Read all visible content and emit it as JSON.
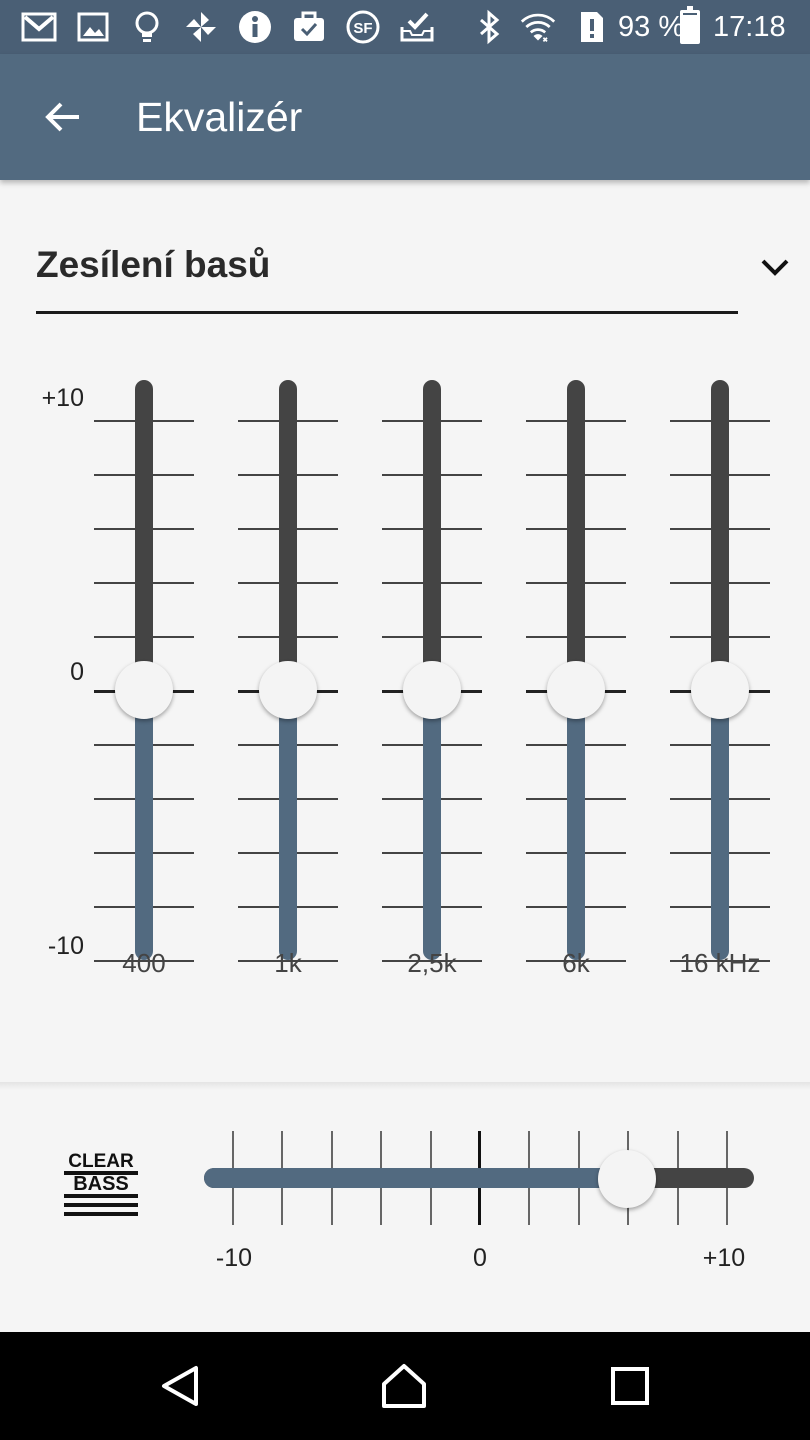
{
  "status_bar": {
    "icons": [
      "gmail-icon",
      "image-icon",
      "lightbulb-icon",
      "pinwheel-icon",
      "info-icon",
      "briefcase-icon",
      "sf-icon",
      "inbox-check-icon",
      "bluetooth-icon",
      "wifi-icon",
      "sim-alert-icon",
      "battery-icon"
    ],
    "battery": "93 %",
    "battery_level": 0.93,
    "time": "17:18"
  },
  "app_bar": {
    "back_icon": "arrow-back-icon",
    "title": "Ekvalizér"
  },
  "preset": {
    "selected": "Zesílení basů",
    "icon": "chevron-down-icon"
  },
  "equalizer": {
    "scale": {
      "max": "+10",
      "zero": "0",
      "min": "-10",
      "range": [
        -10,
        10
      ]
    },
    "bands": [
      {
        "label": "400",
        "value": 0
      },
      {
        "label": "1k",
        "value": 0
      },
      {
        "label": "2,5k",
        "value": 0
      },
      {
        "label": "6k",
        "value": 0
      },
      {
        "label": "16 kHz",
        "value": 0
      }
    ]
  },
  "clear_bass": {
    "logo_text_top": "CLEAR",
    "logo_text_bottom": "BASS",
    "min_label": "-10",
    "zero_label": "0",
    "max_label": "+10",
    "range": [
      -10,
      10
    ],
    "value": 6
  },
  "colors": {
    "status_bar": "#4a5f75",
    "app_bar": "#526a80",
    "track_dark": "#444444",
    "track_accent": "#526a80",
    "background": "#f5f5f5"
  },
  "nav_bar": {
    "back_icon": "nav-back-icon",
    "home_icon": "nav-home-icon",
    "recents_icon": "nav-recents-icon"
  }
}
